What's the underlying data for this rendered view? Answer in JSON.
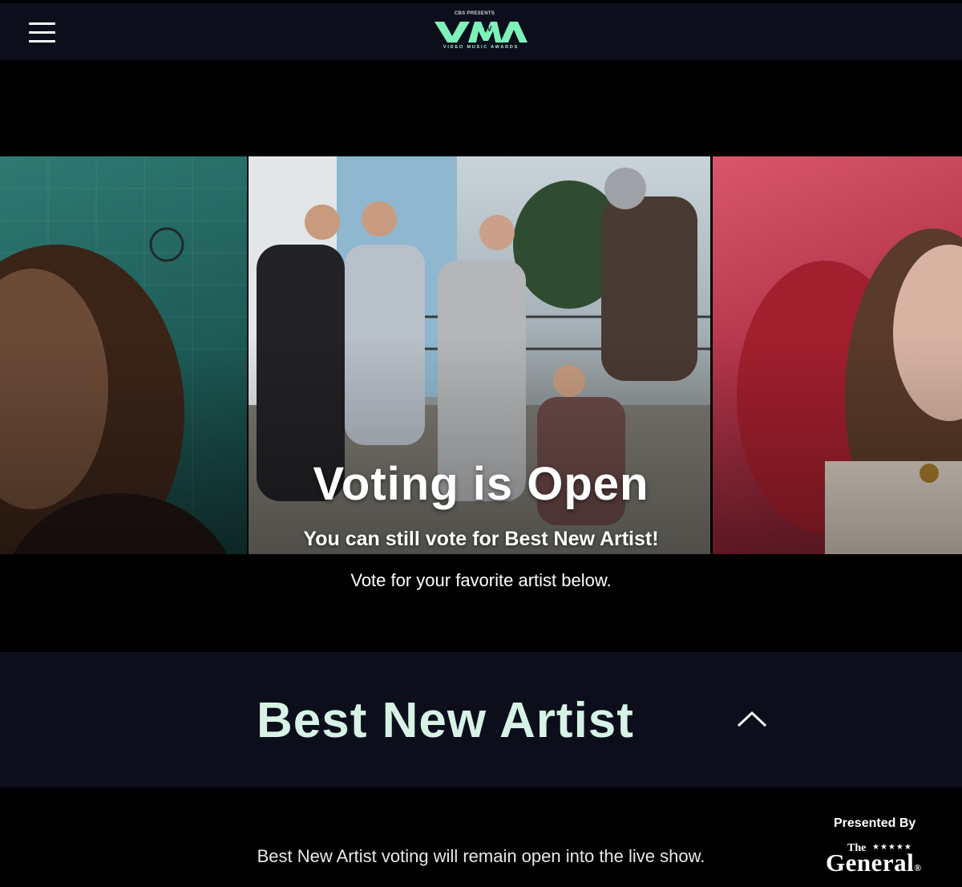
{
  "header": {
    "menu_icon": "hamburger-menu-icon",
    "logo": {
      "presents": "CBS PRESENTS",
      "wordmark": "VMA",
      "subtitle": "VIDEO MUSIC AWARDS",
      "accent_color": "#7ef0b9"
    }
  },
  "hero": {
    "title": "Voting is Open",
    "subtitle": "You can still vote for Best New Artist!",
    "note": "Vote for your favorite artist below."
  },
  "category": {
    "title": "Best New Artist",
    "toggle_icon": "chevron-up-icon",
    "title_color": "#d6f3e5"
  },
  "voting_note": "Best New Artist voting will remain open into the live show.",
  "sponsor": {
    "presented_by": "Presented By",
    "the": "The",
    "stars": "★★★★★",
    "name": "General",
    "mark": "®"
  },
  "colors": {
    "navbar_bg": "#0c0e1c",
    "page_bg": "#000000"
  }
}
